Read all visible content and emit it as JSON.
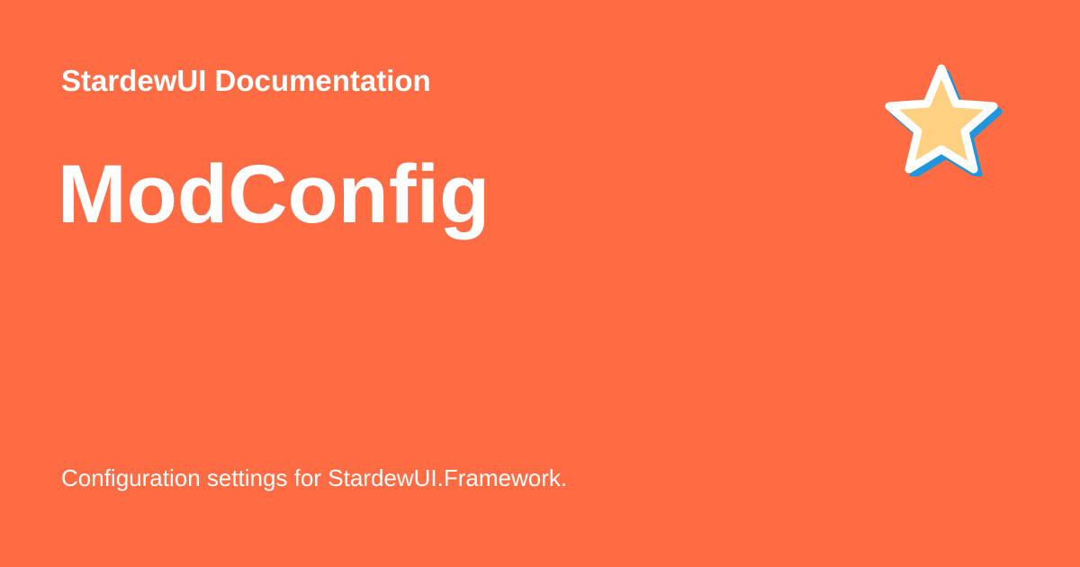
{
  "site_name": "StardewUI Documentation",
  "page_title": "ModConfig",
  "page_description": "Configuration settings for StardewUI.Framework.",
  "logo": {
    "icon": "star-icon",
    "fill_color": "#ffd081",
    "outline_color": "#ffffff",
    "shadow_color": "#1f95dc"
  },
  "colors": {
    "background": "#ff6b43",
    "text": "#ffffff"
  }
}
